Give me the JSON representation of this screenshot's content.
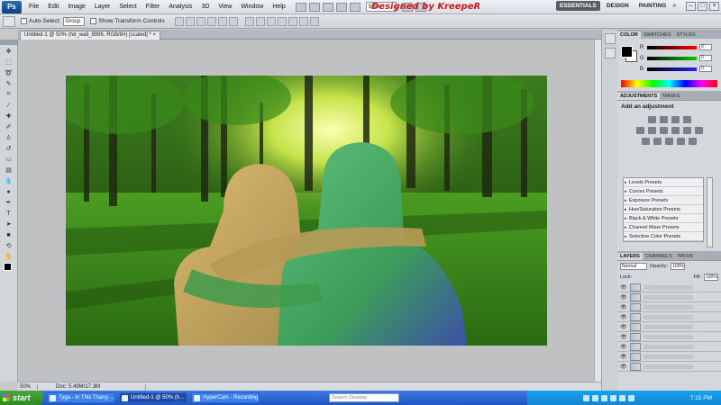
{
  "app": {
    "logo": "Ps",
    "menu": [
      "File",
      "Edit",
      "Image",
      "Layer",
      "Select",
      "Filter",
      "Analysis",
      "3D",
      "View",
      "Window",
      "Help"
    ],
    "zoom_select": "50%",
    "watermark": "Designed by KreepeR",
    "workspaces": [
      "ESSENTIALS",
      "DESIGN",
      "PAINTING"
    ],
    "workspace_more": "»",
    "window_controls": [
      "–",
      "□",
      "×"
    ]
  },
  "options": {
    "auto_select_label": "Auto-Select:",
    "auto_select_value": "Group",
    "transform_label": "Show Transform Controls"
  },
  "document": {
    "tab_title": "Untitled-1 @ 50% (hd_wall_8996, RGB/8#) [scaled] * ×"
  },
  "status": {
    "zoom": "50%",
    "doc_info": "Doc: 5.49M/17.3M"
  },
  "panels": {
    "color_tabs": [
      "COLOR",
      "SWATCHES",
      "STYLES"
    ],
    "color_rows": [
      {
        "label": "R",
        "value": "0",
        "color": "#e02020"
      },
      {
        "label": "G",
        "value": "0",
        "color": "#20b020"
      },
      {
        "label": "B",
        "value": "0",
        "color": "#2040e0"
      }
    ],
    "adj_tabs": [
      "ADJUSTMENTS",
      "MASKS"
    ],
    "adj_title": "Add an adjustment",
    "presets": [
      "Levels Presets",
      "Curves Presets",
      "Exposure Presets",
      "Hue/Saturation Presets",
      "Black & White Presets",
      "Channel Mixer Presets",
      "Selective Color Presets"
    ],
    "layer_tabs": [
      "LAYERS",
      "CHANNELS",
      "PATHS"
    ],
    "blend_mode": "Normal",
    "opacity_label": "Opacity:",
    "opacity_value": "100%",
    "lock_label": "Lock:",
    "fill_label": "Fill:",
    "fill_value": "100%"
  },
  "taskbar": {
    "start": "start",
    "tasks": [
      {
        "label": "Tyga - In This Thang ..."
      },
      {
        "label": "Untitled-1 @ 50% (h..."
      },
      {
        "label": "HyperCam - Recording"
      }
    ],
    "search_placeholder": "Search Desktop",
    "clock": "7:15 PM"
  }
}
